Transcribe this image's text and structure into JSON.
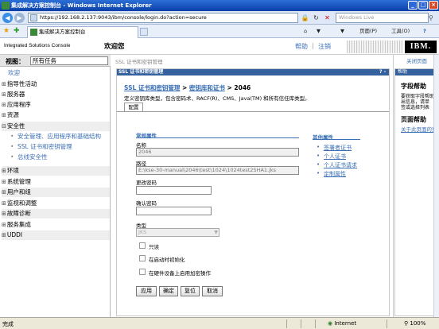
{
  "window": {
    "title": "集成解决方案控制台 - Windows Internet Explorer",
    "minimize": "_",
    "maximize": "□",
    "close": "×"
  },
  "browser": {
    "url": "https://192.168.2.137:9043/ibm/console/login.do?action=secure",
    "search_placeholder": "Windows Live",
    "tab_title": "集成解决方案控制台",
    "tools": {
      "home": "⌂",
      "feeds": "▼",
      "print": "▼",
      "page": "页面(P)",
      "tools": "工具(O)",
      "help": "?"
    }
  },
  "header": {
    "product": "Integrated Solutions Console",
    "welcome": "欢迎您",
    "help": "帮助",
    "separator": "|",
    "logout": "注销",
    "logo": "IBM."
  },
  "nav": {
    "view_label": "视图：",
    "view_value": "所有任务",
    "items": [
      {
        "label": "欢迎"
      },
      {
        "label": "指导性活动"
      },
      {
        "label": "服务器"
      },
      {
        "label": "应用程序"
      },
      {
        "label": "资源"
      },
      {
        "label": "安全性"
      },
      {
        "label": "环境"
      },
      {
        "label": "系统管理"
      },
      {
        "label": "用户和组"
      },
      {
        "label": "监视和调整"
      },
      {
        "label": "故障诊断"
      },
      {
        "label": "服务集成"
      },
      {
        "label": "UDDI"
      }
    ],
    "security_sub": [
      "安全管理、应用程序和基础结构",
      "SSL 证书和密钥管理",
      "总线安全性"
    ]
  },
  "main": {
    "top_breadcrumb": "SSL 证书和密钥管理",
    "panel_title": "SSL 证书和密钥管理",
    "panel_close": "? -",
    "crumb_1": "SSL 证书和密钥管理",
    "crumb_sep": " > ",
    "crumb_2": "密钥库和证书",
    "crumb_3": "2046",
    "description": "定义密钥库类型，包含密码术、RACF(R)、CMS、Java(TM) 和所有信任库类型。",
    "tab": "配置",
    "general_title": "常规属性",
    "fields": {
      "name_label": "名称",
      "name_value": "2046",
      "path_label": "路径",
      "path_value": "E:\\kse-30-manual\\2046\\test\\1024\\1024test2SHA1.jks",
      "change_pwd_label": "更改密码",
      "confirm_pwd_label": "确认密码",
      "type_label": "类型",
      "type_value": "JKS",
      "readonly_label": "只读",
      "init_label": "在启动时初始化",
      "hw_label": "在硬件设备上启用加密操作"
    },
    "other_title": "其他属性",
    "other_links": [
      "签署者证书",
      "个人证书",
      "个人证书请求",
      "定制属性"
    ],
    "buttons": {
      "apply": "应用",
      "ok": "确定",
      "reset": "复位",
      "cancel": "取消"
    }
  },
  "help": {
    "close_page": "关闭页面",
    "head": "帮助",
    "field_help_title": "字段帮助",
    "field_help_lines": [
      "要获取字段帮助",
      "出信息，请单",
      "签或选择列表"
    ],
    "page_help_title": "页面帮助",
    "page_help_link": "关于此页面的更多"
  },
  "status": {
    "left": "完成",
    "zone": "Internet",
    "zoom": "100%"
  },
  "colors": {
    "panel_header": "#35629f",
    "link": "#3a6fb5",
    "titlebar": "#0a3fa8"
  }
}
